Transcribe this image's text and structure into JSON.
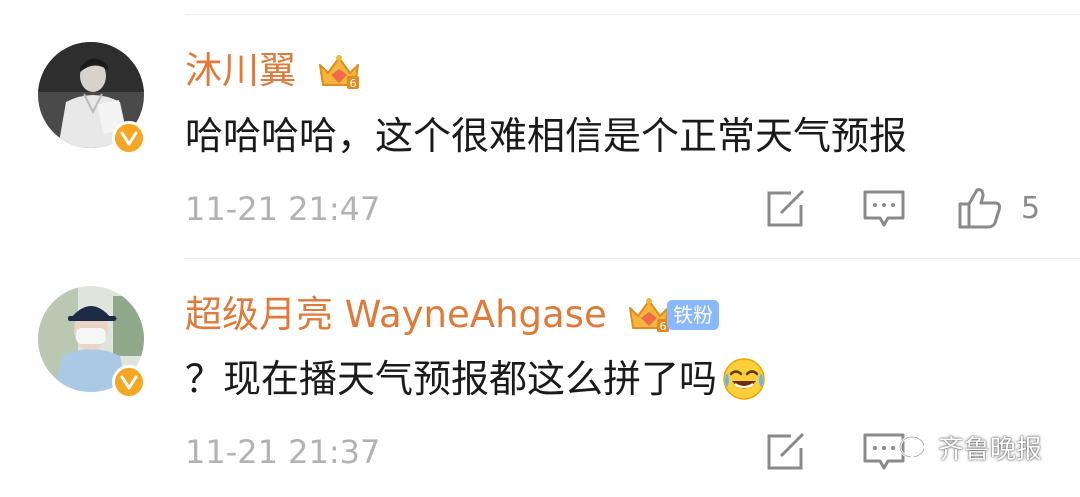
{
  "comments": [
    {
      "username": "沐川翼",
      "text": "哈哈哈哈，这个很难相信是个正常天气预报",
      "time": "11-21 21:47",
      "like_count": "5",
      "level": "6"
    },
    {
      "username": "超级月亮 WayneAhgase",
      "text": "？现在播天气预报都这么拼了吗",
      "time": "11-21 21:37",
      "badge": "铁粉",
      "level": "6",
      "emoji": "laugh-cry-emoji"
    }
  ],
  "watermark": "齐鲁晚报",
  "colors": {
    "username": "#e07a3b",
    "verified": "#f5a623",
    "time": "#b2b2b2"
  }
}
